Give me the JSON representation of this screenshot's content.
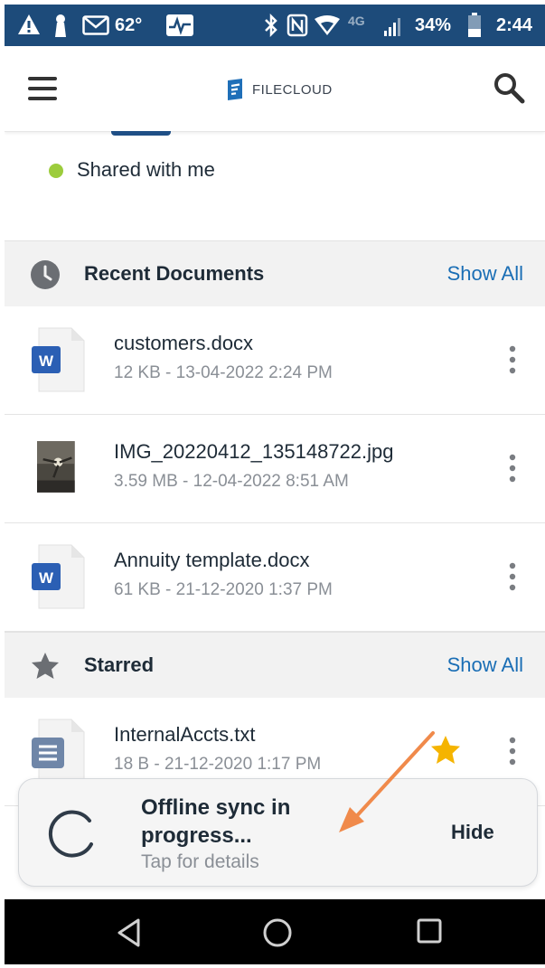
{
  "status_bar": {
    "temperature": "62°",
    "network": "4G",
    "battery": "34%",
    "time": "2:44"
  },
  "app_bar": {
    "logo_text": "FILECLOUD",
    "menu_icon": "hamburger-menu-icon",
    "search_icon": "search-icon"
  },
  "shared": {
    "label": "Shared with me",
    "dot_color": "#9ccc3c"
  },
  "recent": {
    "title": "Recent Documents",
    "show_all": "Show All",
    "icon": "clock-icon",
    "files": [
      {
        "name": "customers.docx",
        "meta": "12 KB - 13-04-2022 2:24 PM",
        "type": "word"
      },
      {
        "name": "IMG_20220412_135148722.jpg",
        "meta": "3.59 MB - 12-04-2022 8:51 AM",
        "type": "image"
      },
      {
        "name": "Annuity template.docx",
        "meta": "61 KB - 21-12-2020 1:37 PM",
        "type": "word"
      }
    ]
  },
  "starred": {
    "title": "Starred",
    "show_all": "Show All",
    "icon": "star-icon",
    "files": [
      {
        "name": "InternalAccts.txt",
        "meta": "18 B - 21-12-2020 1:17 PM",
        "type": "text",
        "starred": true
      }
    ]
  },
  "sync_toast": {
    "title": "Offline sync in progress...",
    "subtitle": "Tap for details",
    "hide_label": "Hide"
  },
  "colors": {
    "status_bar": "#1d4b7a",
    "accent": "#1a6eb5",
    "word_blue": "#2b5fb4",
    "star": "#f5b400",
    "annotation_arrow": "#f08a4b"
  }
}
